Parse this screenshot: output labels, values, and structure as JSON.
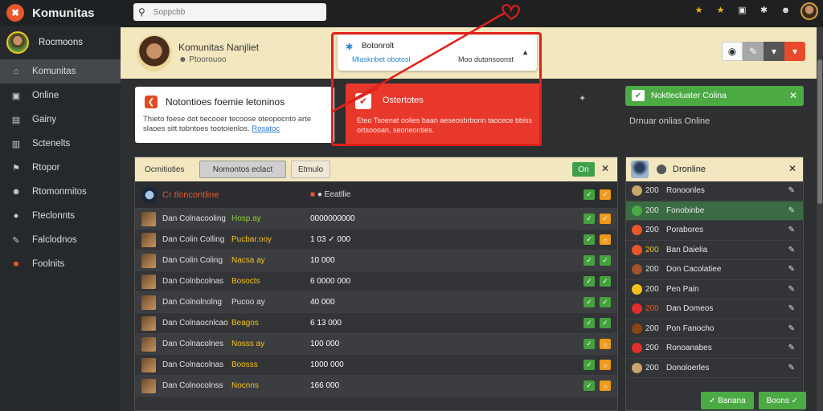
{
  "app": {
    "name": "Komunitas",
    "logo_glyph": "✖"
  },
  "sidebar": {
    "user_label": "Rocmoons",
    "items": [
      {
        "label": "Komunitas",
        "icon": "home-icon",
        "glyph": "⌂",
        "active": true
      },
      {
        "label": "Online",
        "icon": "monitor-icon",
        "glyph": "▣"
      },
      {
        "label": "Gainy",
        "icon": "image-icon",
        "glyph": "▤"
      },
      {
        "label": "Sctenelts",
        "icon": "chart-icon",
        "glyph": "▥"
      },
      {
        "label": "Rtopor",
        "icon": "flag-icon",
        "glyph": "⚑"
      },
      {
        "label": "Rtomonmitos",
        "icon": "people-icon",
        "glyph": "☻"
      },
      {
        "label": "Fteclonnts",
        "icon": "user-icon",
        "glyph": "●"
      },
      {
        "label": "Falclodnos",
        "icon": "tools-icon",
        "glyph": "✎"
      },
      {
        "label": "Foolnits",
        "icon": "badge-icon",
        "glyph": "■",
        "orange": true
      }
    ]
  },
  "topbar": {
    "search_placeholder": "Soppcbb",
    "icons": [
      "star-badge-icon",
      "trophy-icon",
      "calendar-icon",
      "bell-icon",
      "smiley-icon"
    ]
  },
  "profile": {
    "name": "Komunitas Nanjliet",
    "sub": "☻ Ptoorouoo"
  },
  "notification": {
    "title": "Botonrolt",
    "link": "Mlasknbet obotosl",
    "meta": "Moo dutonsoonst"
  },
  "alert_card": {
    "title": "Ostertotes",
    "desc": "Eteo Tsoenat oolies baan aeseosbrbonn taocece bbiss ortsoooan, seoneonties."
  },
  "info_card": {
    "title": "Notontioes foemie letoninos",
    "desc": "Thieto foese dot tiecooer tecoose oteopocnto arte slaoes sitt tobntoes tootoienlos.",
    "link": "Rosatoc"
  },
  "online_card": {
    "title": "Noktlecluater Colina",
    "sub": "Drnuar onlias Online"
  },
  "table": {
    "tabs": [
      "Ocmitioties",
      "Nomontos eclact",
      "Etmulo"
    ],
    "online_btn": "On",
    "header_row": {
      "name": "Cr tloncontline",
      "val": "Eeatllie"
    },
    "rows": [
      {
        "name": "Dan Colnacooling",
        "tag": "Hosp.ay",
        "tag_color": "#8fd13a",
        "val": "0000000000",
        "right": "orange-flat"
      },
      {
        "name": "Dan Colin Colling",
        "tag": "Pucbar.ooy",
        "tag_color": "#f5c21b",
        "val": "1 03 ✓ 000",
        "right": "orange"
      },
      {
        "name": "Dan Colin Coling",
        "tag": "Nacsa ay",
        "tag_color": "#f5c21b",
        "val": "10 000",
        "right": "green"
      },
      {
        "name": "Dan Colnbcolnas",
        "tag": "Bosocts",
        "tag_color": "#f5c21b",
        "val": "6 0000 000",
        "right": "green"
      },
      {
        "name": "Dan Colnolnolng",
        "tag": "Pucoo ay",
        "tag_color": "#e0e0e0",
        "val": "40 000",
        "right": "green"
      },
      {
        "name": "Dan Colnaocnlcao",
        "tag": "Beagos",
        "tag_color": "#f5c21b",
        "val": "6 13 000",
        "right": "green"
      },
      {
        "name": "Dan Colnacolnes",
        "tag": "Nosss ay",
        "tag_color": "#f5c21b",
        "val": "100 000",
        "right": "orange"
      },
      {
        "name": "Dan Colnacolnas",
        "tag": "Boosss",
        "tag_color": "#f5c21b",
        "val": "1000 000",
        "right": "orange"
      },
      {
        "name": "Dan Colnocolnss",
        "tag": "Nocnns",
        "tag_color": "#f5c21b",
        "val": "166 000",
        "right": "orange"
      }
    ]
  },
  "list": {
    "title": "Dronline",
    "rows": [
      {
        "num": "200",
        "name": "Ronoonles",
        "icon_color": "#c8a56a"
      },
      {
        "num": "200",
        "name": "Fonobinbe",
        "icon_color": "#4caa45",
        "hi": true
      },
      {
        "num": "200",
        "name": "Porabores",
        "icon_color": "#e8562a"
      },
      {
        "num": "200",
        "name": "Ban Daielia",
        "icon_color": "#e8562a",
        "num_color": "#f5c21b"
      },
      {
        "num": "200",
        "name": "Don Cacolatiee",
        "icon_color": "#a0522d"
      },
      {
        "num": "200",
        "name": "Pen Pain",
        "icon_color": "#f5c21b"
      },
      {
        "num": "200",
        "name": "Dan Domeos",
        "icon_color": "#e0302a",
        "num_color": "#e8562a"
      },
      {
        "num": "200",
        "name": "Pon Fanocho",
        "icon_color": "#8b4513"
      },
      {
        "num": "200",
        "name": "Ronoanabes",
        "icon_color": "#e0302a"
      },
      {
        "num": "200",
        "name": "Donoloerles",
        "icon_color": "#c8a56a"
      }
    ]
  },
  "footer_buttons": [
    "✓ Banana",
    "Boons ✓"
  ]
}
